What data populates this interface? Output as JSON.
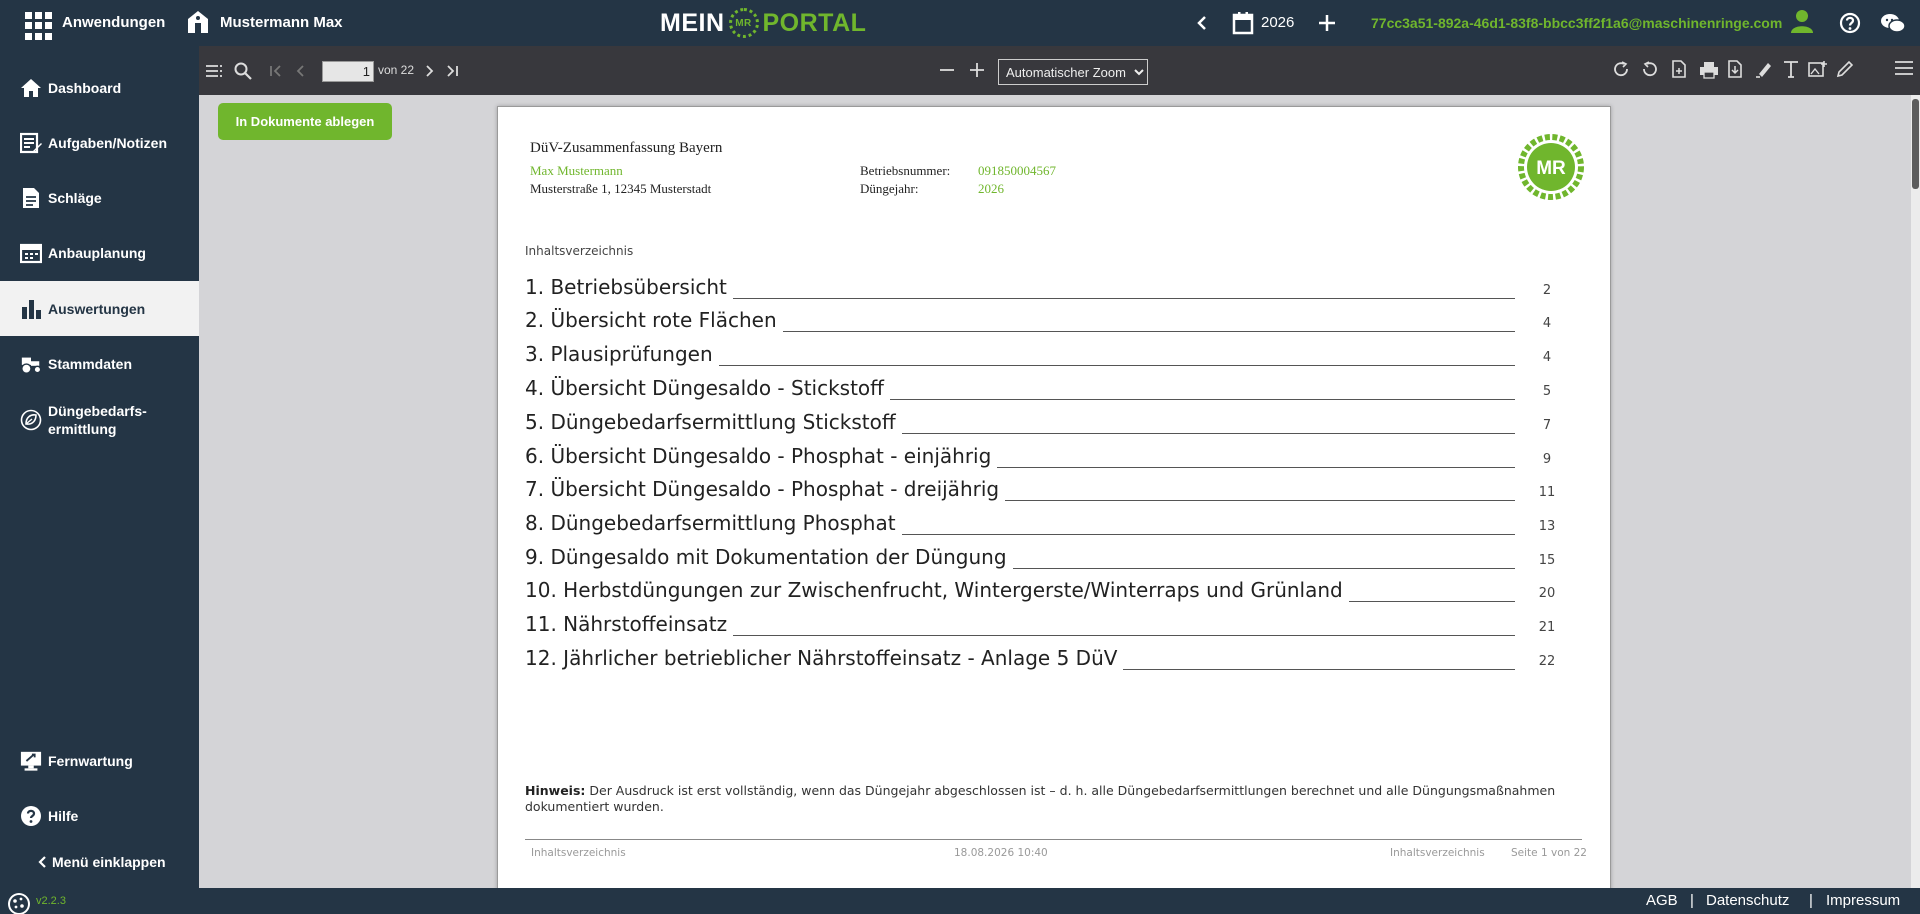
{
  "topbar": {
    "apps_label": "Anwendungen",
    "user_name": "Mustermann Max",
    "logo_left": "MEIN",
    "logo_badge": "MR",
    "logo_right": "PORTAL",
    "year": "2026",
    "email": "77cc3a51-892a-46d1-83f8-bbcc3ff2f1a6@maschinenringe.com"
  },
  "sidebar": {
    "items": [
      {
        "label": "Dashboard",
        "icon": "home-icon"
      },
      {
        "label": "Aufgaben/Notizen",
        "icon": "notes-icon"
      },
      {
        "label": "Schläge",
        "icon": "document-icon"
      },
      {
        "label": "Anbauplanung",
        "icon": "calendar-icon"
      },
      {
        "label": "Auswertungen",
        "icon": "bar-chart-icon",
        "active": true
      },
      {
        "label": "Stammdaten",
        "icon": "tractor-icon"
      },
      {
        "label": "Düngebedarfs-",
        "label2": "ermittlung",
        "icon": "leaf-icon"
      },
      {
        "label": "Fernwartung",
        "icon": "remote-icon"
      },
      {
        "label": "Hilfe",
        "icon": "help-icon"
      }
    ],
    "collapse_label": "Menü einklappen"
  },
  "pdf_toolbar": {
    "page_current": "1",
    "page_of": "von 22",
    "zoom_value": "Automatischer Zoom"
  },
  "viewer": {
    "save_button": "In Dokumente ablegen"
  },
  "document": {
    "title": "DüV-Zusammenfassung Bayern",
    "farmer_name": "Max Mustermann",
    "address": "Musterstraße 1, 12345 Musterstadt",
    "farm_number_label": "Betriebsnummer:",
    "farm_number": "091850004567",
    "year_label": "Düngejahr:",
    "year": "2026",
    "badge": "MR",
    "toc_heading": "Inhaltsverzeichnis",
    "toc": [
      {
        "title": "1. Betriebsübersicht",
        "page": "2"
      },
      {
        "title": "2. Übersicht rote Flächen",
        "page": "4"
      },
      {
        "title": "3. Plausiprüfungen",
        "page": "4"
      },
      {
        "title": "4. Übersicht Düngesaldo - Stickstoff",
        "page": "5"
      },
      {
        "title": "5. Düngebedarfsermittlung Stickstoff",
        "page": "7"
      },
      {
        "title": "6. Übersicht Düngesaldo - Phosphat - einjährig",
        "page": "9"
      },
      {
        "title": "7. Übersicht Düngesaldo - Phosphat - dreijährig",
        "page": "11"
      },
      {
        "title": "8. Düngebedarfsermittlung Phosphat",
        "page": "13"
      },
      {
        "title": "9. Düngesaldo mit Dokumentation der Düngung",
        "page": "15"
      },
      {
        "title": "10. Herbstdüngungen zur Zwischenfrucht, Wintergerste/Winterraps und Grünland",
        "page": "20"
      },
      {
        "title": "11. Nährstoffeinsatz",
        "page": "21"
      },
      {
        "title": "12. Jährlicher betrieblicher Nährstoffeinsatz - Anlage 5 DüV",
        "page": "22"
      }
    ],
    "hint_label": "Hinweis:",
    "hint_text": " Der Ausdruck ist erst vollständig, wenn das Düngejahr abgeschlossen ist – d. h. alle Düngebedarfsermittlungen berechnet und alle Düngungsmaßnahmen dokumentiert wurden.",
    "footer_left": "Inhaltsverzeichnis",
    "footer_center": "18.08.2026 10:40",
    "footer_right": "Inhaltsverzeichnis",
    "footer_page": "Seite 1 von 22"
  },
  "bottombar": {
    "version": "v2.2.3",
    "agb": "AGB",
    "datenschutz": "Datenschutz",
    "impressum": "Impressum",
    "separator": "|"
  },
  "colors": {
    "navy": "#243545",
    "green": "#70b62d",
    "pdf_toolbar": "#38383d"
  }
}
